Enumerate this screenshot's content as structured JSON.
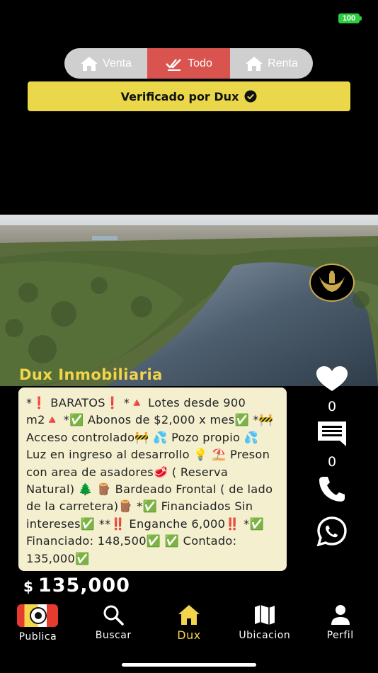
{
  "status_bar": {
    "battery": "100"
  },
  "segmented": {
    "items": [
      {
        "label": "Venta",
        "icon": "home-icon",
        "active": false
      },
      {
        "label": "Todo",
        "icon": "double-check-icon",
        "active": true
      },
      {
        "label": "Renta",
        "icon": "home-icon",
        "active": false
      }
    ],
    "active_color": "#d9534f"
  },
  "banner": {
    "label": "Verificado por Dux",
    "icon": "check-circle-icon",
    "color": "#ebd84a"
  },
  "listing": {
    "photo_icon": "aerial-river-photo",
    "agency_logo_icon": "agency-logo-icon",
    "agency_name": "Dux Inmobiliaria",
    "description": "*❗ BARATOS❗ *🔺 Lotes desde 900 m2🔺 *✅ Abonos de $2,000 x mes✅ *🚧 Acceso controlado🚧 💦 Pozo propio 💦  Luz en ingreso al desarrollo 💡 ⛱️ Preson con area de asadores🥩 ( Reserva Natural) 🌲 🪵 Bardeado Frontal ( de lado de la carretera)🪵 *✅ Financiados Sin intereses✅ **‼️ Enganche 6,000‼️ *✅ Financiado: 148,500✅ ✅ Contado: 135,000✅",
    "price_currency": "$",
    "price": "135,000"
  },
  "actions": {
    "likes": "0",
    "comments": "0",
    "like_icon": "heart-icon",
    "comment_icon": "comment-icon",
    "call_icon": "phone-icon",
    "whatsapp_icon": "whatsapp-icon"
  },
  "tabbar": {
    "items": [
      {
        "label": "Publica",
        "icon": "camera-icon"
      },
      {
        "label": "Buscar",
        "icon": "search-icon"
      },
      {
        "label": "Dux",
        "icon": "home-icon",
        "active": true
      },
      {
        "label": "Ubicacion",
        "icon": "map-icon"
      },
      {
        "label": "Perfil",
        "icon": "person-icon"
      }
    ],
    "active_color": "#f2d54a"
  }
}
